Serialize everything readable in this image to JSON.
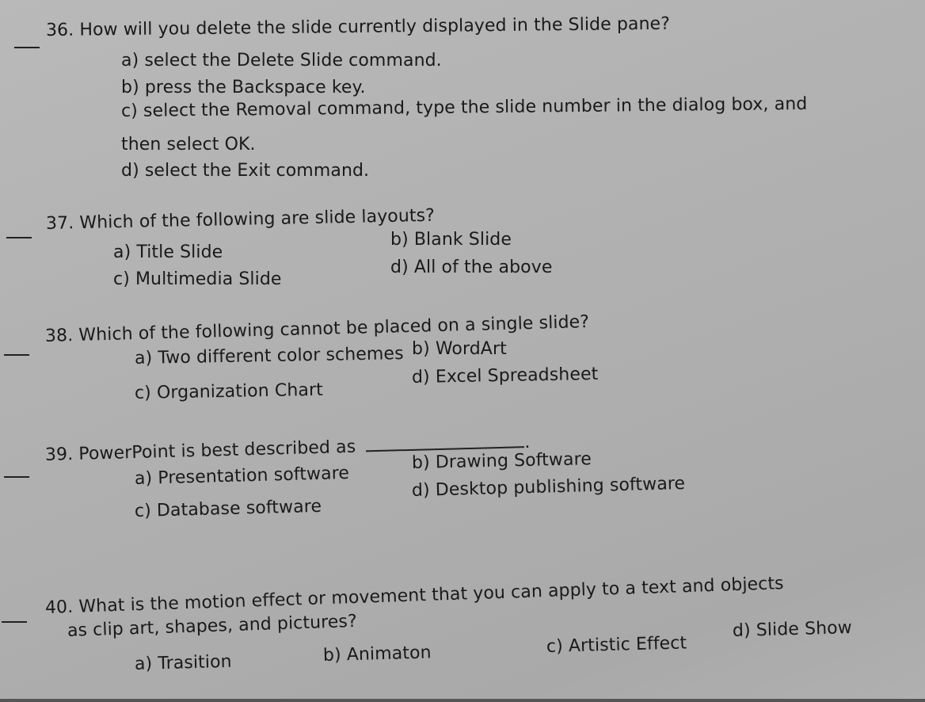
{
  "questions": [
    {
      "number": "36.",
      "stem": "How will you delete the slide currently displayed in the Slide pane?",
      "options": {
        "a": "a) select the Delete Slide command.",
        "b": "b) press the Backspace key.",
        "c": "c) select the Removal command, type the slide number in the dialog box, and",
        "c_cont": "then select OK.",
        "d": "d) select the Exit command."
      }
    },
    {
      "number": "37.",
      "stem": "Which of the following are slide layouts?",
      "options": {
        "a": "a) Title Slide",
        "b": "b) Blank Slide",
        "c": "c) Multimedia Slide",
        "d": "d) All of the above"
      }
    },
    {
      "number": "38.",
      "stem": "Which of the following cannot be placed on a single slide?",
      "options": {
        "a": "a) Two different color schemes",
        "b": "b) WordArt",
        "c": "c) Organization Chart",
        "d": "d) Excel Spreadsheet"
      }
    },
    {
      "number": "39.",
      "stem": "PowerPoint is best described as",
      "stem_end": ".",
      "options": {
        "a": "a) Presentation software",
        "b": "b) Drawing Software",
        "c": "c) Database software",
        "d": "d) Desktop publishing software"
      }
    },
    {
      "number": "40.",
      "stem": "What is the motion effect or movement that you can apply to a text and objects",
      "stem_cont": "as clip art, shapes, and pictures?",
      "options": {
        "a": "a) Trasition",
        "b": "b) Animaton",
        "c": "c) Artistic Effect",
        "d": "d) Slide Show"
      }
    }
  ]
}
